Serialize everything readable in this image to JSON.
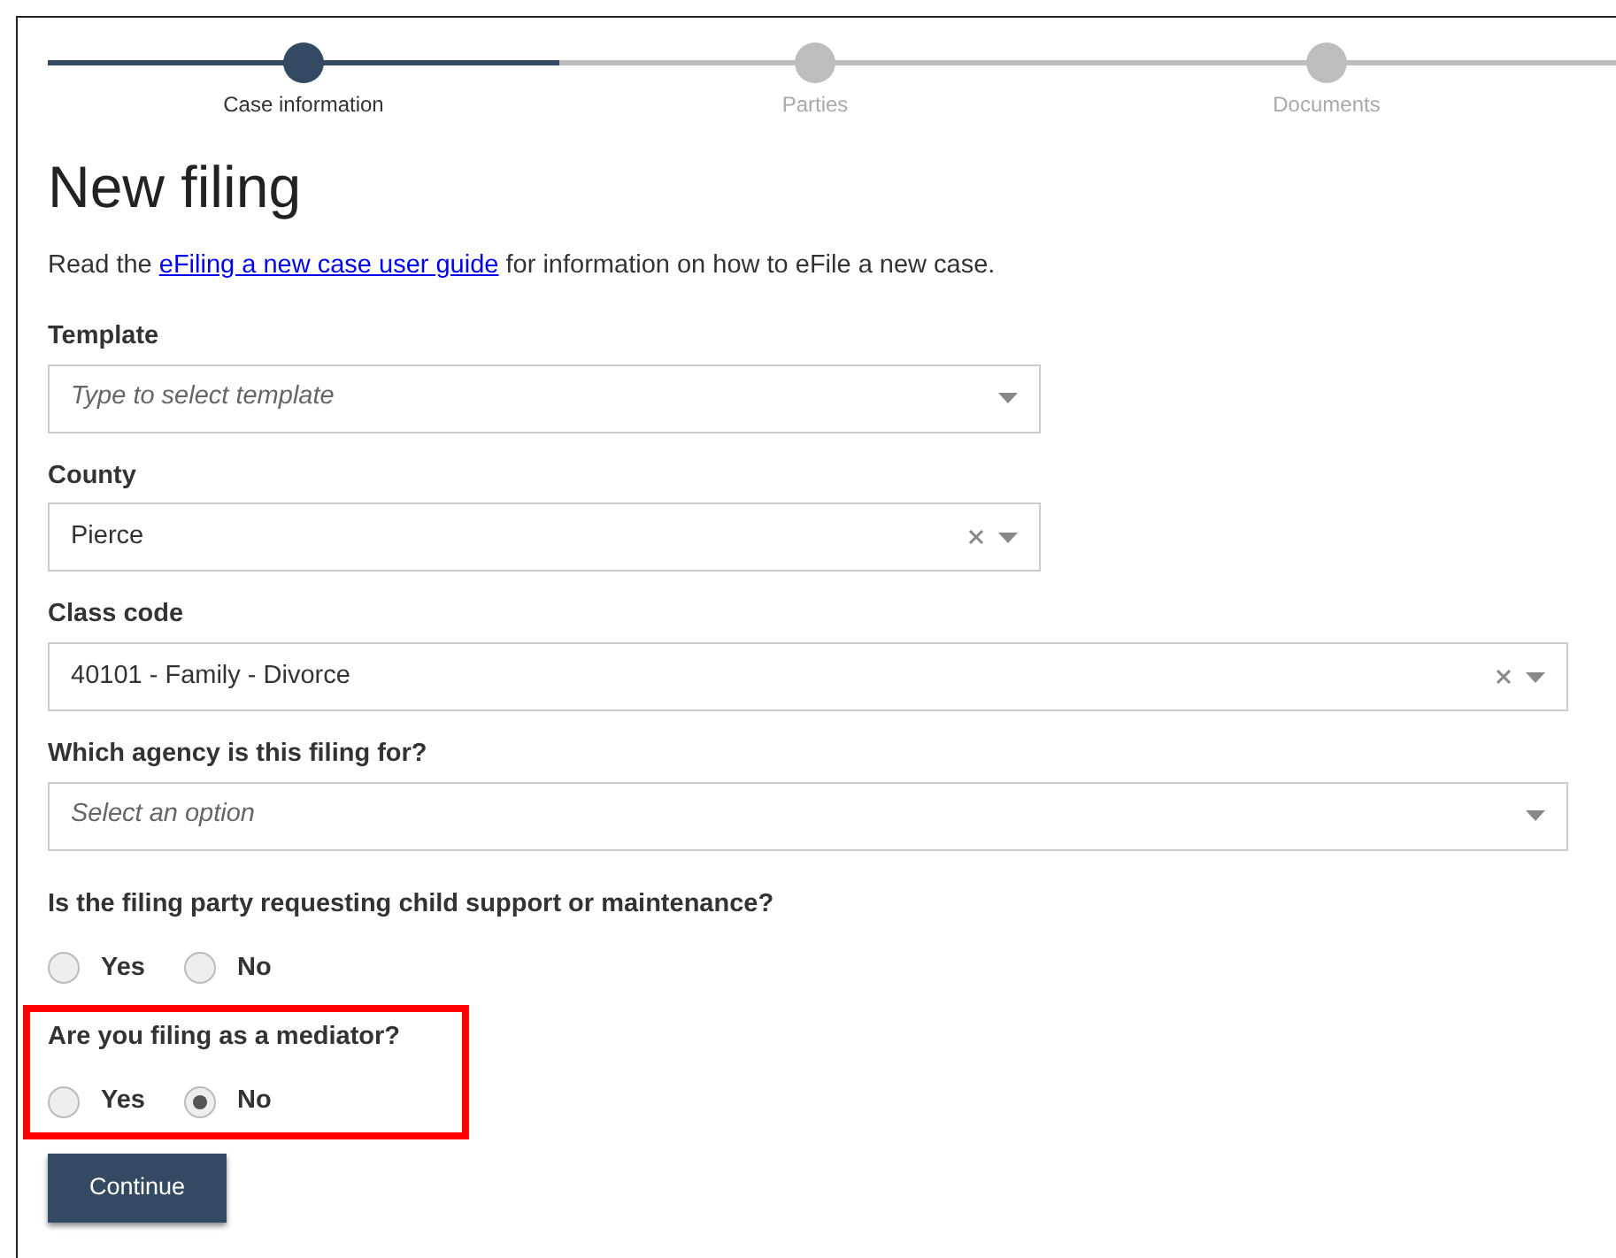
{
  "steps": [
    {
      "label": "Case information",
      "selected": true
    },
    {
      "label": "Parties",
      "selected": false
    },
    {
      "label": "Documents",
      "selected": false
    }
  ],
  "title": "New filing",
  "intro": {
    "before": "Read the ",
    "link": "eFiling a new case user guide",
    "after": " for information on how to eFile a new case."
  },
  "fields": [
    {
      "label": "Template",
      "placeholder": "Type to select template",
      "clearable": false
    },
    {
      "label": "County",
      "value": "Pierce",
      "clearable": true
    },
    {
      "label": "Class code",
      "value": "40101 - Family - Divorce",
      "clearable": true
    },
    {
      "label": "Which agency is this filing for?",
      "placeholder": "Select an option",
      "clearable": false
    }
  ],
  "questions": [
    {
      "label": "Is the filing party requesting child support or maintenance?",
      "highlighted": false,
      "options": [
        {
          "label": "Yes",
          "selected": false
        },
        {
          "label": "No",
          "selected": false
        }
      ]
    },
    {
      "label": "Are you filing as a mediator?",
      "highlighted": true,
      "options": [
        {
          "label": "Yes",
          "selected": false
        },
        {
          "label": "No",
          "selected": true
        }
      ]
    }
  ],
  "continue_button": "Continue"
}
